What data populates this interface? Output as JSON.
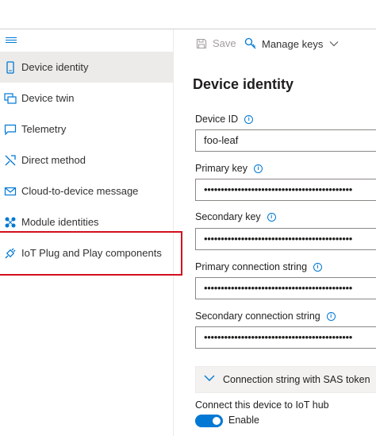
{
  "sidebar": {
    "items": [
      {
        "label": "Device identity",
        "icon": "device-icon",
        "active": true
      },
      {
        "label": "Device twin",
        "icon": "device-twin-icon"
      },
      {
        "label": "Telemetry",
        "icon": "telemetry-icon"
      },
      {
        "label": "Direct method",
        "icon": "direct-method-icon"
      },
      {
        "label": "Cloud-to-device message",
        "icon": "message-icon"
      },
      {
        "label": "Module identities",
        "icon": "module-identities-icon"
      },
      {
        "label": "IoT Plug and Play components",
        "icon": "plug-icon"
      }
    ]
  },
  "toolbar": {
    "save_label": "Save",
    "manage_keys_label": "Manage keys"
  },
  "main": {
    "title": "Device identity",
    "device_id_label": "Device ID",
    "device_id_value": "foo-leaf",
    "primary_key_label": "Primary key",
    "primary_key_value": "••••••••••••••••••••••••••••••••••••••••••••",
    "secondary_key_label": "Secondary key",
    "secondary_key_value": "••••••••••••••••••••••••••••••••••••••••••••",
    "primary_conn_label": "Primary connection string",
    "primary_conn_value": "••••••••••••••••••••••••••••••••••••••••••••",
    "secondary_conn_label": "Secondary connection string",
    "secondary_conn_value": "••••••••••••••••••••••••••••••••••••••••••••",
    "sas_label": "Connection string with SAS token",
    "connect_label": "Connect this device to IoT hub",
    "enable_label": "Enable"
  },
  "colors": {
    "accent": "#0078d4",
    "highlight": "#d20f1e"
  }
}
